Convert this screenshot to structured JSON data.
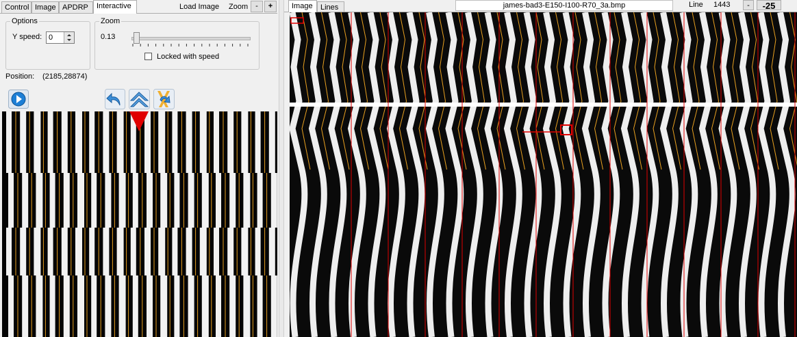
{
  "left_panel": {
    "tabs": [
      {
        "label": "Control"
      },
      {
        "label": "Image"
      },
      {
        "label": "APDRP"
      },
      {
        "label": "Interactive"
      }
    ],
    "active_tab": "Interactive",
    "load_image_label": "Load Image",
    "zoom_label": "Zoom",
    "zoom_minus_label": "-",
    "zoom_plus_label": "+",
    "options": {
      "legend": "Options",
      "y_speed_label": "Y speed:",
      "y_speed_value": "0"
    },
    "zoom_group": {
      "legend": "Zoom",
      "value_text": "0.13",
      "slider_level": 0.02,
      "locked_label": "Locked with speed",
      "locked_checked": false
    },
    "position": {
      "label": "Position:",
      "value": "(2185,28874)"
    },
    "icons": [
      "play-icon",
      "undo-arrow-icon",
      "double-chevron-up-icon",
      "swap-arrows-icon",
      "red-triangle-marker-icon"
    ]
  },
  "right_panel": {
    "tabs": [
      {
        "label": "Image"
      },
      {
        "label": "Lines"
      }
    ],
    "active_tab": "Image",
    "filename": "james-bad3-E150-I100-R70_3a.bmp",
    "line_label": "Line",
    "line_value": "1443",
    "step_minus_label": "-",
    "step_value": "-25"
  },
  "colors": {
    "trace_orange": "#e8a020",
    "marker_red": "#e00000",
    "window_bg": "#f0f0f0"
  }
}
